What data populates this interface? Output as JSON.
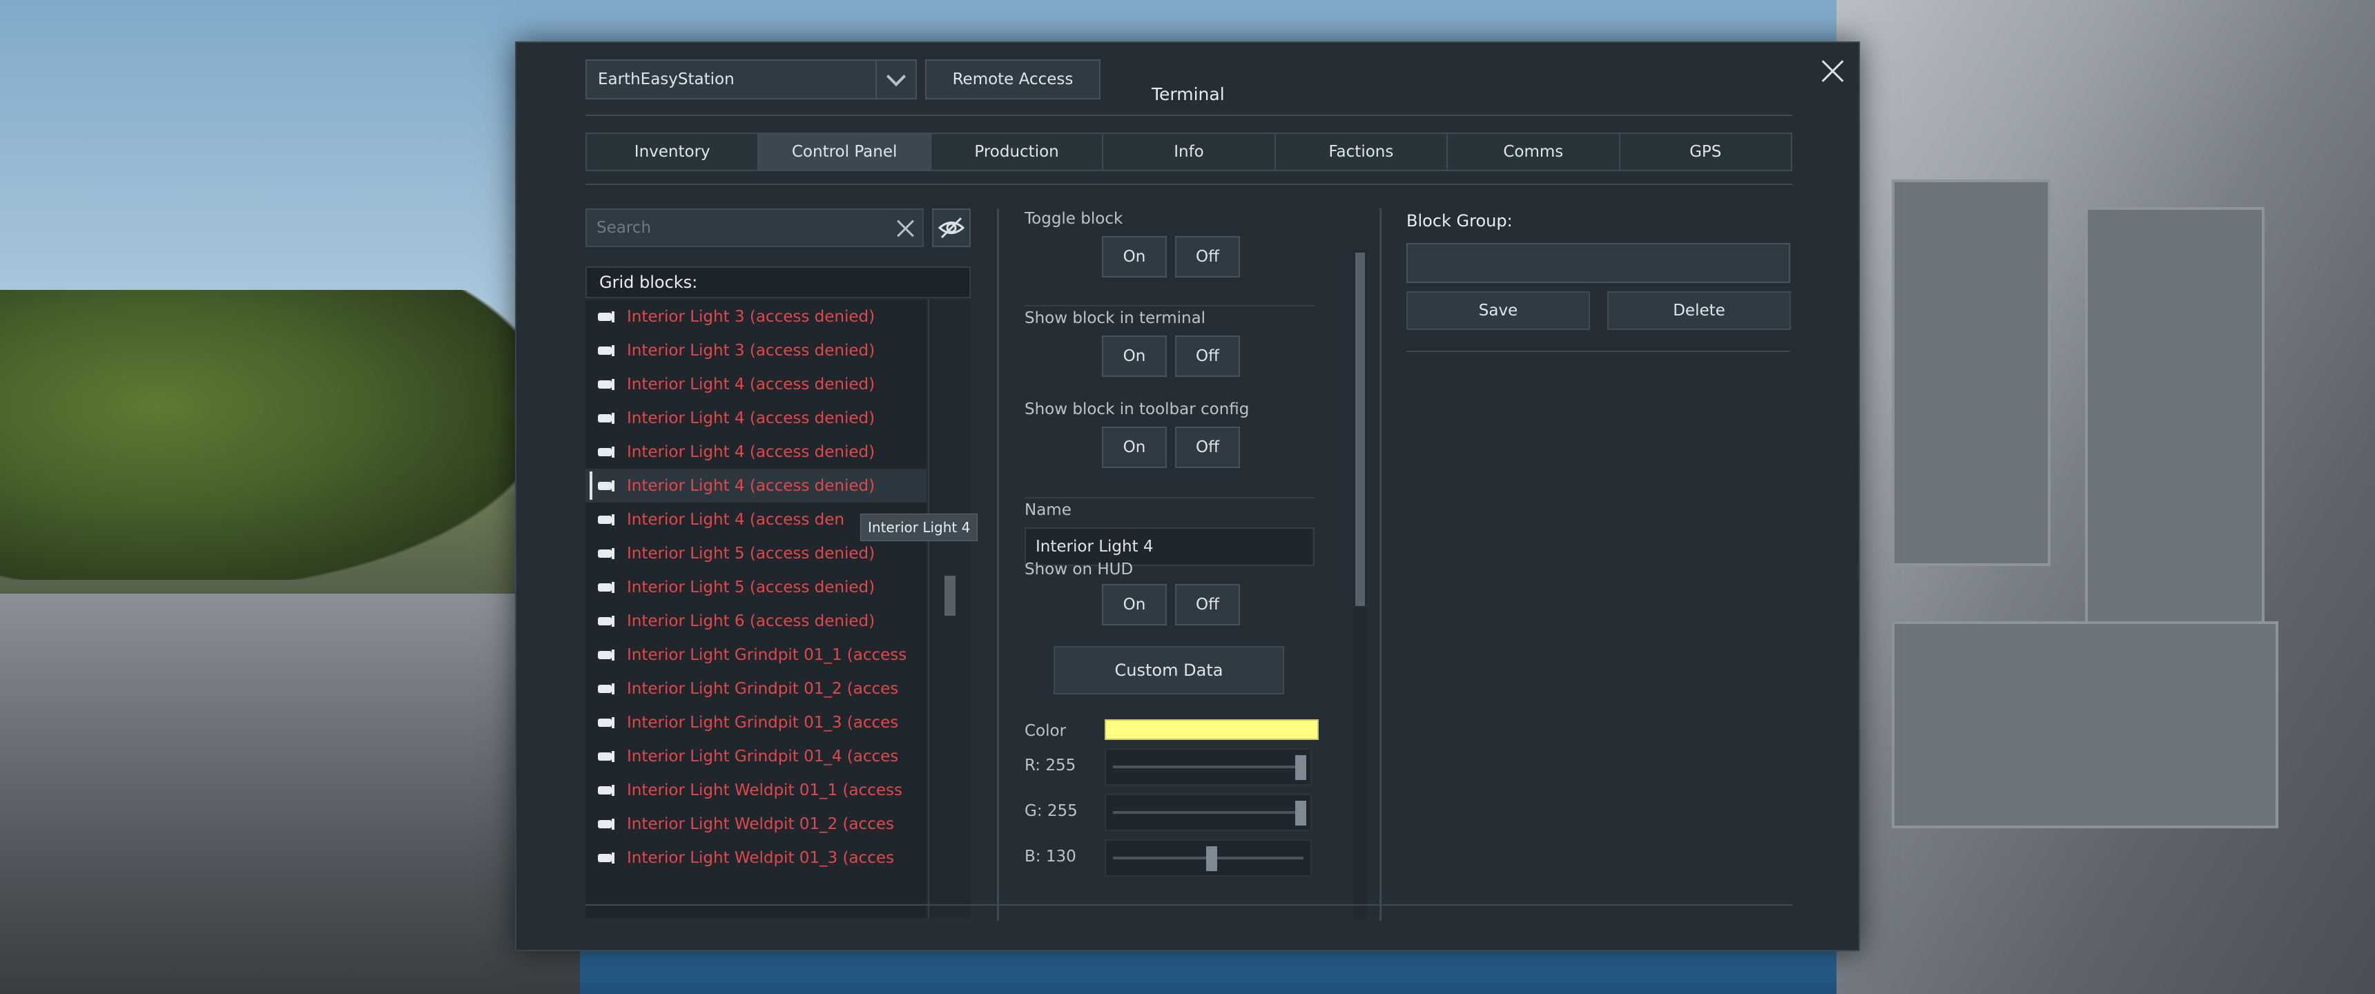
{
  "terminal": {
    "title": "Terminal",
    "grid_name": "EarthEasyStation",
    "remote_access_label": "Remote Access",
    "tabs": [
      {
        "label": "Inventory",
        "active": false
      },
      {
        "label": "Control Panel",
        "active": true
      },
      {
        "label": "Production",
        "active": false
      },
      {
        "label": "Info",
        "active": false
      },
      {
        "label": "Factions",
        "active": false
      },
      {
        "label": "Comms",
        "active": false
      },
      {
        "label": "GPS",
        "active": false
      }
    ]
  },
  "block_list": {
    "search_placeholder": "Search",
    "header": "Grid blocks:",
    "tooltip": "Interior Light 4",
    "selected_index": 5,
    "items": [
      "Interior Light 3 (access denied)",
      "Interior Light 3 (access denied)",
      "Interior Light 4 (access denied)",
      "Interior Light 4 (access denied)",
      "Interior Light 4 (access denied)",
      "Interior Light 4 (access denied)",
      "Interior Light 4 (access den",
      "Interior Light 5 (access denied)",
      "Interior Light 5 (access denied)",
      "Interior Light 6 (access denied)",
      "Interior Light Grindpit 01_1 (access",
      "Interior Light Grindpit 01_2 (acces",
      "Interior Light Grindpit 01_3 (acces",
      "Interior Light Grindpit 01_4 (acces",
      "Interior Light Weldpit 01_1 (access",
      "Interior Light Weldpit 01_2 (acces",
      "Interior Light Weldpit 01_3 (acces"
    ]
  },
  "block_panel": {
    "toggle_block_label": "Toggle block",
    "show_in_terminal_label": "Show block in terminal",
    "show_in_toolbar_label": "Show block in toolbar config",
    "name_label": "Name",
    "name_value": "Interior Light 4",
    "show_on_hud_label": "Show on HUD",
    "on_label": "On",
    "off_label": "Off",
    "custom_data_label": "Custom Data",
    "color_label": "Color",
    "color_hex": "#ffff82",
    "r_label": "R: 255",
    "g_label": "G: 255",
    "b_label": "B: 130",
    "r_value": 255,
    "g_value": 255,
    "b_value": 130
  },
  "block_group": {
    "label": "Block Group:",
    "save_label": "Save",
    "delete_label": "Delete"
  },
  "colors": {
    "denied_text": "#e2474c",
    "panel_bg": "#252e35"
  }
}
